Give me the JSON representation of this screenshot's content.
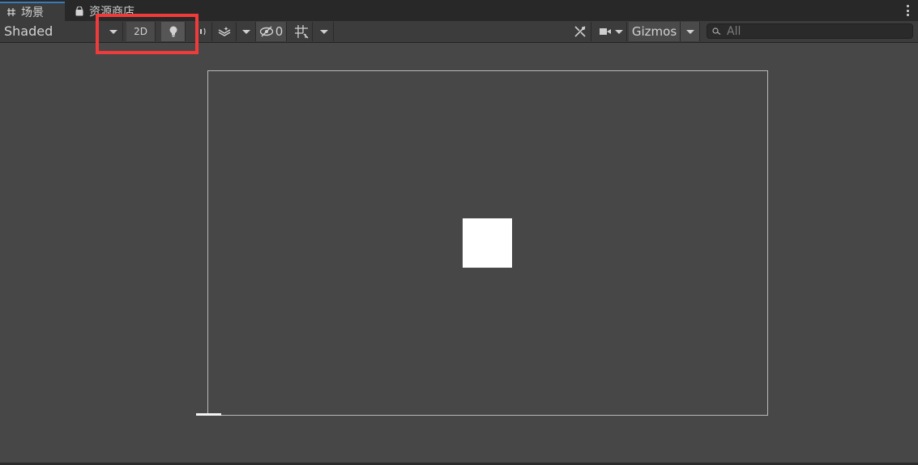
{
  "tabs": [
    {
      "label": "场景",
      "icon": "grid-icon",
      "active": true
    },
    {
      "label": "资源商店",
      "icon": "shopping-bag-icon",
      "active": false
    }
  ],
  "toolbar": {
    "draw_mode": "Shaded",
    "two_d_label": "2D",
    "hidden_count": "0",
    "gizmos_label": "Gizmos",
    "search_placeholder": "All"
  },
  "colors": {
    "accent_tab": "#3a79bb",
    "highlight": "#f03b3b",
    "viewport_bg": "#474747"
  }
}
